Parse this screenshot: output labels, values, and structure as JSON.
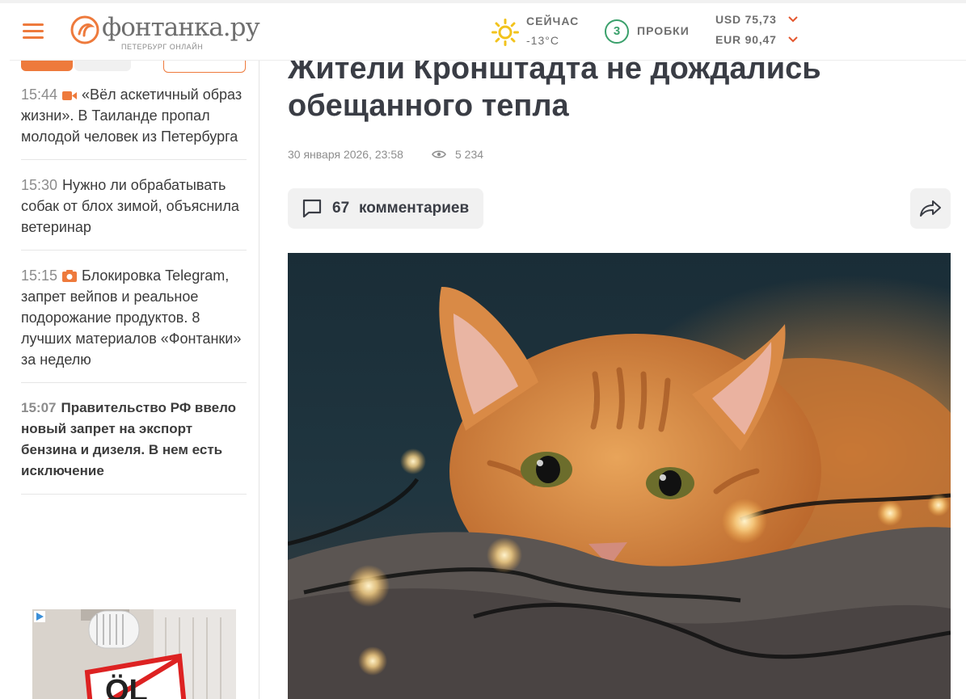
{
  "header": {
    "logo_name": "фонтанка.ру",
    "logo_sub": "ПЕТЕРБУРГ ОНЛАЙН",
    "weather": {
      "label": "СЕЙЧАС",
      "temp": "-13°C"
    },
    "traffic": {
      "level": "3",
      "label": "ПРОБКИ",
      "color": "#3aa06b"
    },
    "rates": [
      {
        "text": "USD 75,73"
      },
      {
        "text": "EUR 90,47"
      }
    ],
    "accent": "#ee7a3c"
  },
  "sidebar": {
    "news": [
      {
        "time": "15:44",
        "icon": "video-icon",
        "text": "«Вёл аскетичный образ жизни». В Таиланде пропал молодой человек из Петербурга"
      },
      {
        "time": "15:30",
        "icon": "",
        "text": "Нужно ли обрабатывать собак от блох зимой, объяснила ветеринар"
      },
      {
        "time": "15:15",
        "icon": "camera-icon",
        "text": "Блокировка Telegram, запрет вейпов и реальное подорожание продуктов. 8 лучших материалов «Фонтанки» за неделю"
      },
      {
        "time": "15:07",
        "icon": "",
        "text": "Правительство РФ ввело новый запрет на экспорт бензина и дизеля. В нем есть исключение",
        "bold": true
      }
    ],
    "ad_text": "ÖL"
  },
  "article": {
    "title": "Жители Кронштадта не дождались обещанного тепла",
    "date": "30 января 2026, 23:58",
    "views": "5 234",
    "comments_count": "67",
    "comments_label": "комментариев"
  }
}
